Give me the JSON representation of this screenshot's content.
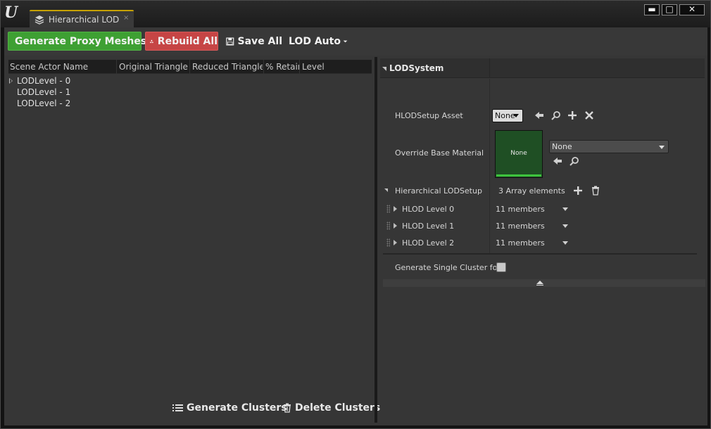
{
  "app": {
    "tab_title": "Hierarchical LOD O",
    "tab_close": "×",
    "window_controls": {
      "minimize": "▬",
      "maximize": "□",
      "close": "✕"
    }
  },
  "toolbar": {
    "generate_proxy_label": "Generate Proxy Meshes",
    "rebuild_all_label": "Rebuild All",
    "save_all_label": "Save All",
    "lod_auto_label": "LOD Auto"
  },
  "outliner": {
    "columns": [
      "Scene Actor Name",
      "Original Triangle C",
      "Reduced Triangle",
      "% Retair",
      "Level"
    ],
    "rows": [
      "LODLevel - 0",
      "LODLevel - 1",
      "LODLevel - 2"
    ]
  },
  "bottom_actions": {
    "generate_clusters_label": "Generate Clusters",
    "delete_clusters_label": "Delete Clusters"
  },
  "details": {
    "category": "LODSystem",
    "hlod_setup_asset_label": "HLODSetup Asset",
    "hlod_setup_asset_value": "None",
    "override_material_label": "Override Base Material",
    "override_material_thumb": "None",
    "override_material_value": "None",
    "hlod_setup_label": "Hierarchical LODSetup",
    "hlod_setup_count": "3 Array elements",
    "levels": [
      {
        "label": "HLOD Level 0",
        "value": "11 members"
      },
      {
        "label": "HLOD Level 1",
        "value": "11 members"
      },
      {
        "label": "HLOD Level 2",
        "value": "11 members"
      }
    ],
    "single_cluster_label": "Generate Single Cluster for",
    "single_cluster_checked": false
  },
  "colors": {
    "proxy_button": "#3ea033",
    "rebuild_button": "#c64545",
    "tab_accent": "#c8a300",
    "thumbnail_bg": "#1f4f24"
  }
}
